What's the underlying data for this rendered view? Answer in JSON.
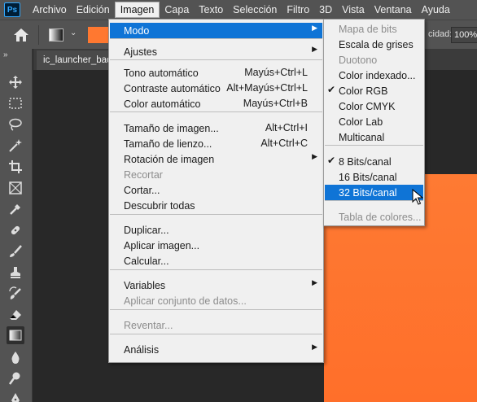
{
  "menubar": {
    "logo": "Ps",
    "items": [
      "Archivo",
      "Edición",
      "Imagen",
      "Capa",
      "Texto",
      "Selección",
      "Filtro",
      "3D",
      "Vista",
      "Ventana",
      "Ayuda"
    ],
    "active_index": 2
  },
  "options": {
    "opacity_label": "cidad:",
    "opacity_value": "100%",
    "fg_color": "#ff7830"
  },
  "document": {
    "tab_title": "ic_launcher_background",
    "canvas_color": "#ff7430"
  },
  "imagen_menu": {
    "items": [
      {
        "label": "Modo",
        "submenu": true,
        "highlight": true
      },
      {
        "label": "Ajustes",
        "submenu": true
      },
      {
        "label": "Tono automático",
        "shortcut": "Mayús+Ctrl+L"
      },
      {
        "label": "Contraste automático",
        "shortcut": "Alt+Mayús+Ctrl+L"
      },
      {
        "label": "Color automático",
        "shortcut": "Mayús+Ctrl+B"
      },
      {
        "label": "Tamaño de imagen...",
        "shortcut": "Alt+Ctrl+I"
      },
      {
        "label": "Tamaño de lienzo...",
        "shortcut": "Alt+Ctrl+C"
      },
      {
        "label": "Rotación de imagen",
        "submenu": true
      },
      {
        "label": "Recortar",
        "disabled": true
      },
      {
        "label": "Cortar..."
      },
      {
        "label": "Descubrir todas"
      },
      {
        "label": "Duplicar..."
      },
      {
        "label": "Aplicar imagen..."
      },
      {
        "label": "Calcular..."
      },
      {
        "label": "Variables",
        "submenu": true
      },
      {
        "label": "Aplicar conjunto de datos...",
        "disabled": true
      },
      {
        "label": "Reventar...",
        "disabled": true
      },
      {
        "label": "Análisis",
        "submenu": true
      }
    ]
  },
  "modo_menu": {
    "items": [
      {
        "label": "Mapa de bits",
        "disabled": true
      },
      {
        "label": "Escala de grises"
      },
      {
        "label": "Duotono",
        "disabled": true
      },
      {
        "label": "Color indexado..."
      },
      {
        "label": "Color RGB",
        "checked": true
      },
      {
        "label": "Color CMYK"
      },
      {
        "label": "Color Lab"
      },
      {
        "label": "Multicanal"
      },
      {
        "label": "8 Bits/canal",
        "checked": true
      },
      {
        "label": "16 Bits/canal"
      },
      {
        "label": "32 Bits/canal",
        "highlight": true
      },
      {
        "label": "Tabla de colores...",
        "disabled": true
      }
    ]
  },
  "tools": [
    "move-icon",
    "marquee-icon",
    "lasso-icon",
    "magic-wand-icon",
    "crop-icon",
    "frame-icon",
    "eyedropper-icon",
    "healing-brush-icon",
    "brush-icon",
    "clone-stamp-icon",
    "history-brush-icon",
    "eraser-icon",
    "gradient-icon",
    "blur-icon",
    "dodge-icon",
    "pen-icon"
  ]
}
